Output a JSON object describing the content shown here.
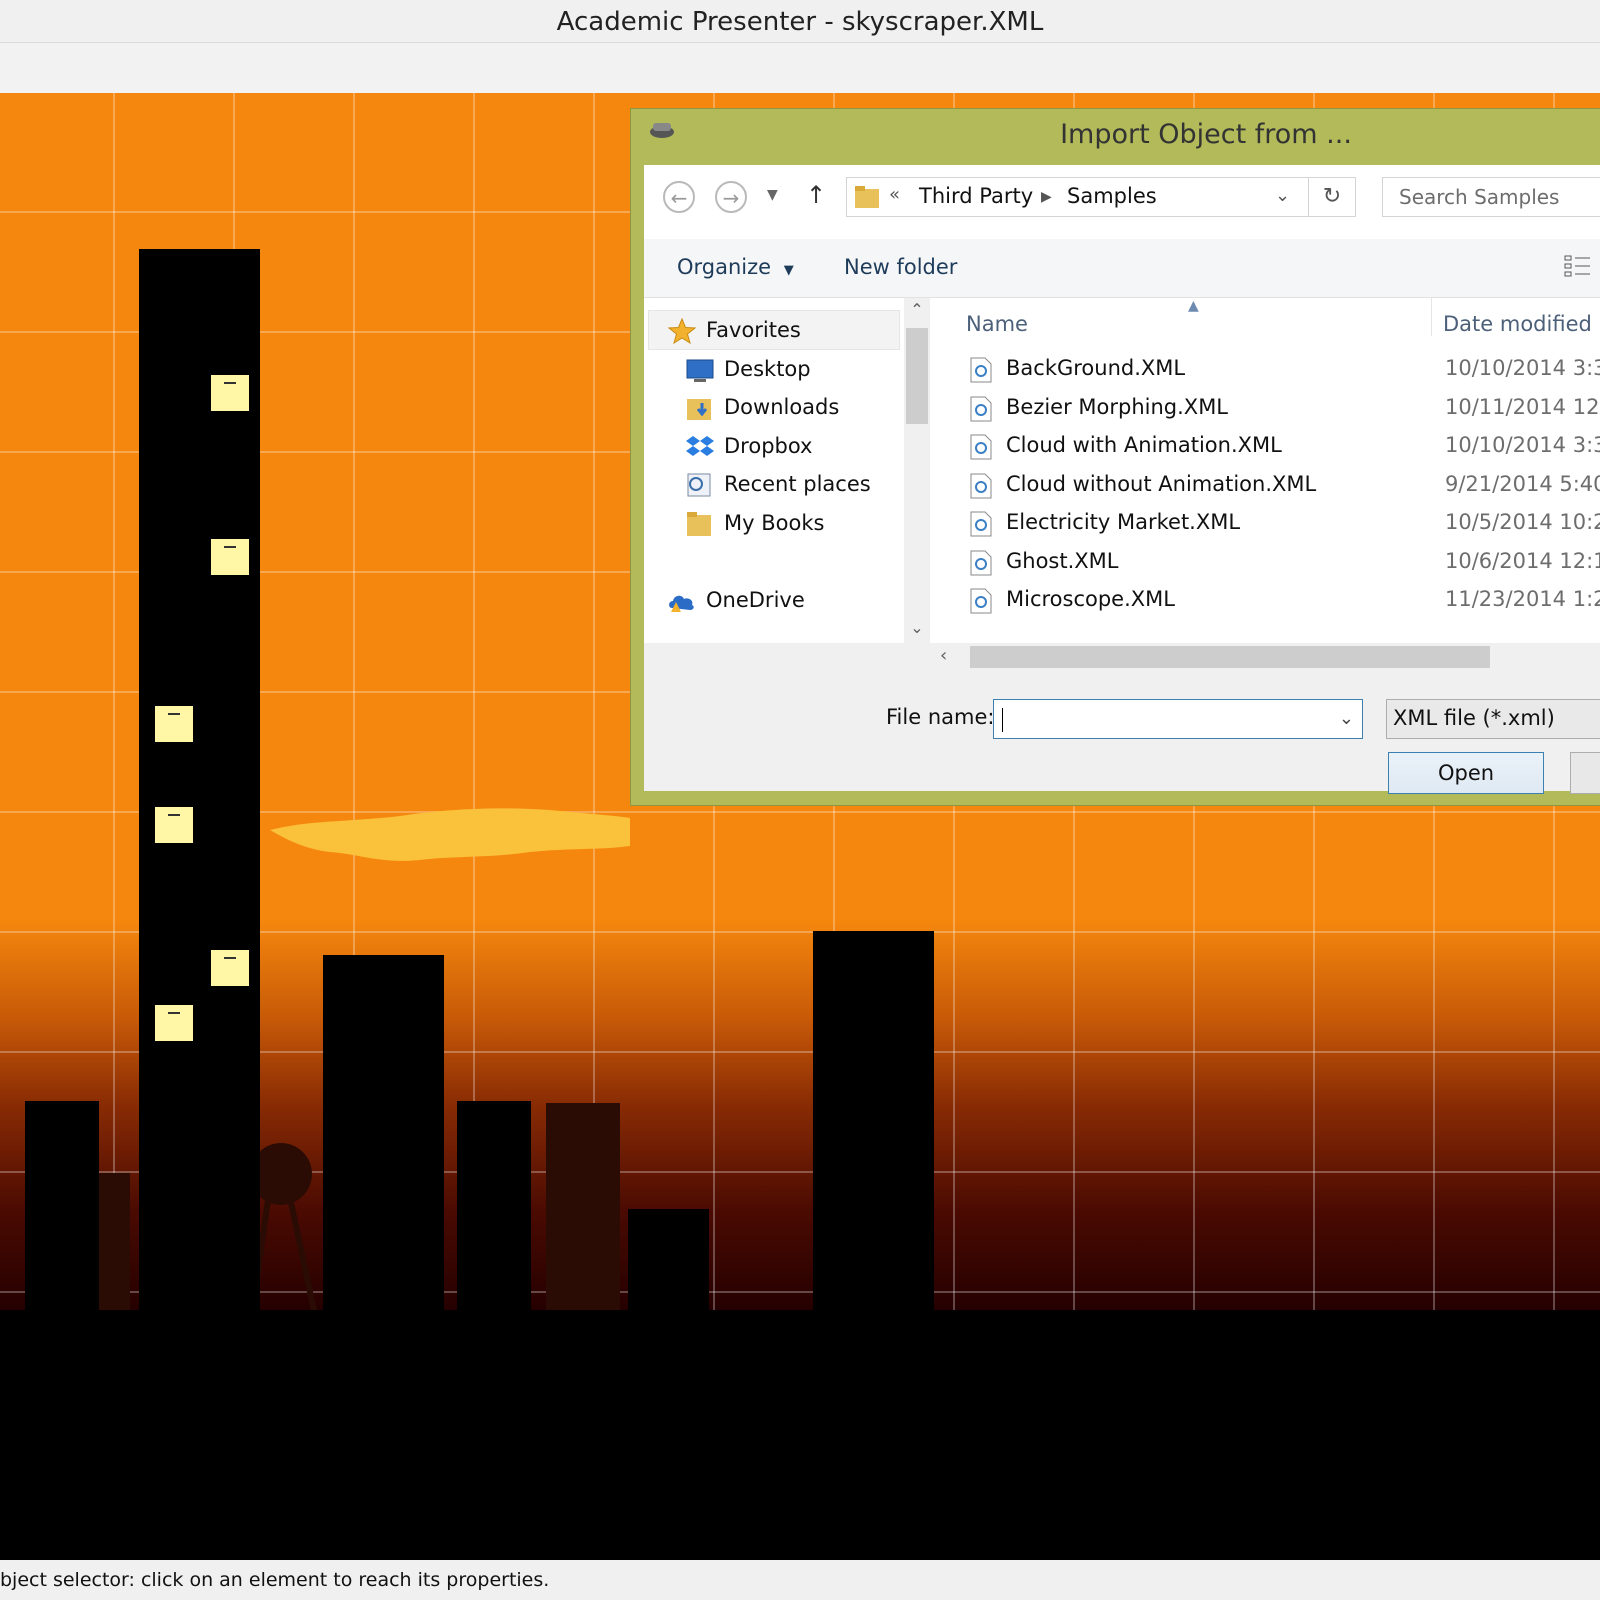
{
  "window": {
    "title": "Academic Presenter - skyscraper.XML"
  },
  "dialog": {
    "title": "Import Object from ...",
    "breadcrumb": {
      "prefix": "«",
      "items": [
        "Third Party",
        "Samples"
      ]
    },
    "search_placeholder": "Search Samples",
    "commands": {
      "organize": "Organize",
      "new_folder": "New folder"
    },
    "nav_items": [
      {
        "label": "Favorites",
        "icon": "star-icon"
      },
      {
        "label": "Desktop",
        "icon": "desktop-icon"
      },
      {
        "label": "Downloads",
        "icon": "downloads-folder-icon"
      },
      {
        "label": "Dropbox",
        "icon": "dropbox-icon"
      },
      {
        "label": "Recent places",
        "icon": "recent-places-icon"
      },
      {
        "label": "My Books",
        "icon": "folder-icon"
      },
      {
        "label": "OneDrive",
        "icon": "onedrive-icon"
      }
    ],
    "columns": {
      "name": "Name",
      "date": "Date modified"
    },
    "files": [
      {
        "name": "BackGround.XML",
        "date": "10/10/2014 3:3"
      },
      {
        "name": "Bezier Morphing.XML",
        "date": "10/11/2014 12:"
      },
      {
        "name": "Cloud with Animation.XML",
        "date": "10/10/2014 3:3"
      },
      {
        "name": "Cloud without Animation.XML",
        "date": "9/21/2014 5:40"
      },
      {
        "name": "Electricity Market.XML",
        "date": "10/5/2014 10:2"
      },
      {
        "name": "Ghost.XML",
        "date": "10/6/2014 12:1"
      },
      {
        "name": "Microscope.XML",
        "date": "11/23/2014 1:2"
      }
    ],
    "file_name_label": "File name:",
    "file_name_value": "",
    "file_type": "XML file (*.xml)",
    "open_label": "Open"
  },
  "status": {
    "text": "bject selector: click on an element to reach its properties."
  },
  "colors": {
    "sky": "#f5870e",
    "dialog_frame": "#b2ba5a",
    "window_light": "#fff6a6"
  }
}
